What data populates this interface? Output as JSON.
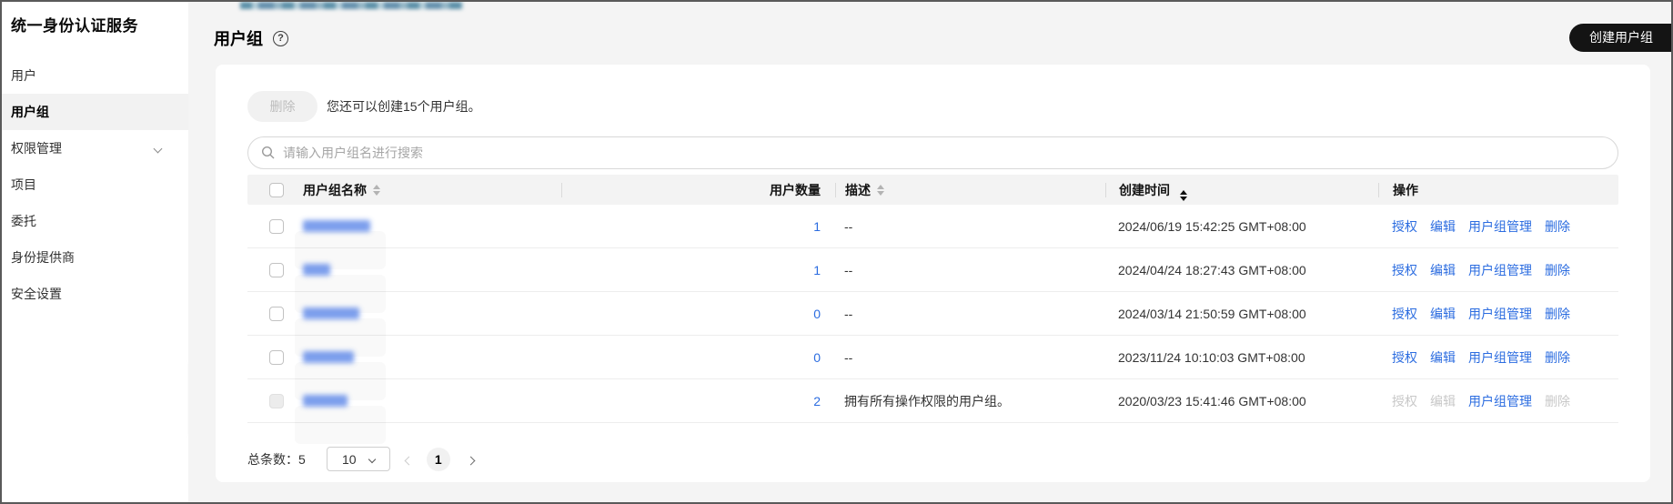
{
  "sidebar": {
    "title": "统一身份认证服务",
    "items": [
      {
        "label": "用户"
      },
      {
        "label": "用户组"
      },
      {
        "label": "权限管理"
      },
      {
        "label": "项目"
      },
      {
        "label": "委托"
      },
      {
        "label": "身份提供商"
      },
      {
        "label": "安全设置"
      }
    ]
  },
  "page": {
    "title": "用户组",
    "help_icon": "?",
    "create_button": "创建用户组"
  },
  "toolbar": {
    "delete_button": "删除",
    "quota_hint": "您还可以创建15个用户组。",
    "search_placeholder": "请输入用户组名进行搜索"
  },
  "table": {
    "columns": {
      "name": "用户组名称",
      "user_count": "用户数量",
      "description": "描述",
      "created": "创建时间",
      "actions": "操作"
    },
    "action_labels": {
      "authorize": "授权",
      "edit": "编辑",
      "manage": "用户组管理",
      "delete": "删除"
    },
    "rows": [
      {
        "name_redacted": true,
        "user_count": "1",
        "description": "--",
        "created": "2024/06/19 15:42:25 GMT+08:00"
      },
      {
        "name_redacted": true,
        "user_count": "1",
        "description": "--",
        "created": "2024/04/24 18:27:43 GMT+08:00"
      },
      {
        "name_redacted": true,
        "user_count": "0",
        "description": "--",
        "created": "2024/03/14 21:50:59 GMT+08:00"
      },
      {
        "name_redacted": true,
        "user_count": "0",
        "description": "--",
        "created": "2023/11/24 10:10:03 GMT+08:00"
      },
      {
        "name_redacted": true,
        "user_count": "2",
        "description": "拥有所有操作权限的用户组。",
        "created": "2020/03/23 15:41:46 GMT+08:00"
      }
    ]
  },
  "pagination": {
    "total_label": "总条数：",
    "total_count": "5",
    "page_size": "10",
    "current_page": "1"
  },
  "colors": {
    "link_blue": "#2b6ce0",
    "button_black": "#141414",
    "page_bg": "#f4f4f4"
  }
}
